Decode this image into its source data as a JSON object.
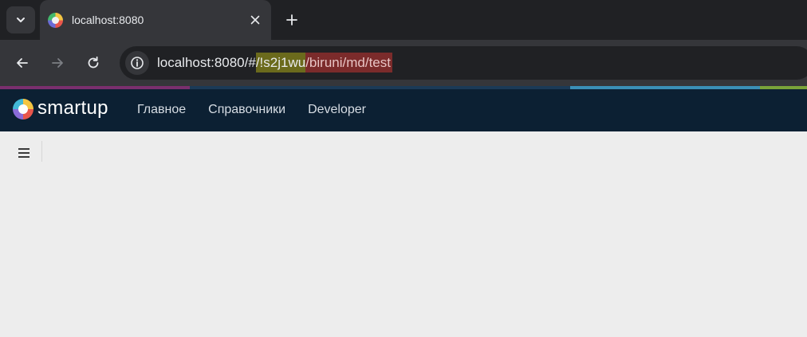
{
  "browser": {
    "tab": {
      "title": "localhost:8080"
    },
    "url": {
      "host": "localhost:8080/#",
      "segment_1": "/!s2j1wu",
      "segment_2": "/biruni/md/test"
    },
    "icons": {
      "tab_search": "chevron-down-icon",
      "tab_close": "close-icon",
      "new_tab": "plus-icon",
      "back": "arrow-left-icon",
      "forward": "arrow-right-icon",
      "reload": "reload-icon",
      "site_info": "info-icon"
    }
  },
  "app": {
    "brand": "smartup",
    "nav": [
      {
        "label": "Главное"
      },
      {
        "label": "Справочники"
      },
      {
        "label": "Developer"
      }
    ],
    "colors": {
      "header_bg": "#0c2033",
      "content_bg": "#ededed"
    }
  }
}
